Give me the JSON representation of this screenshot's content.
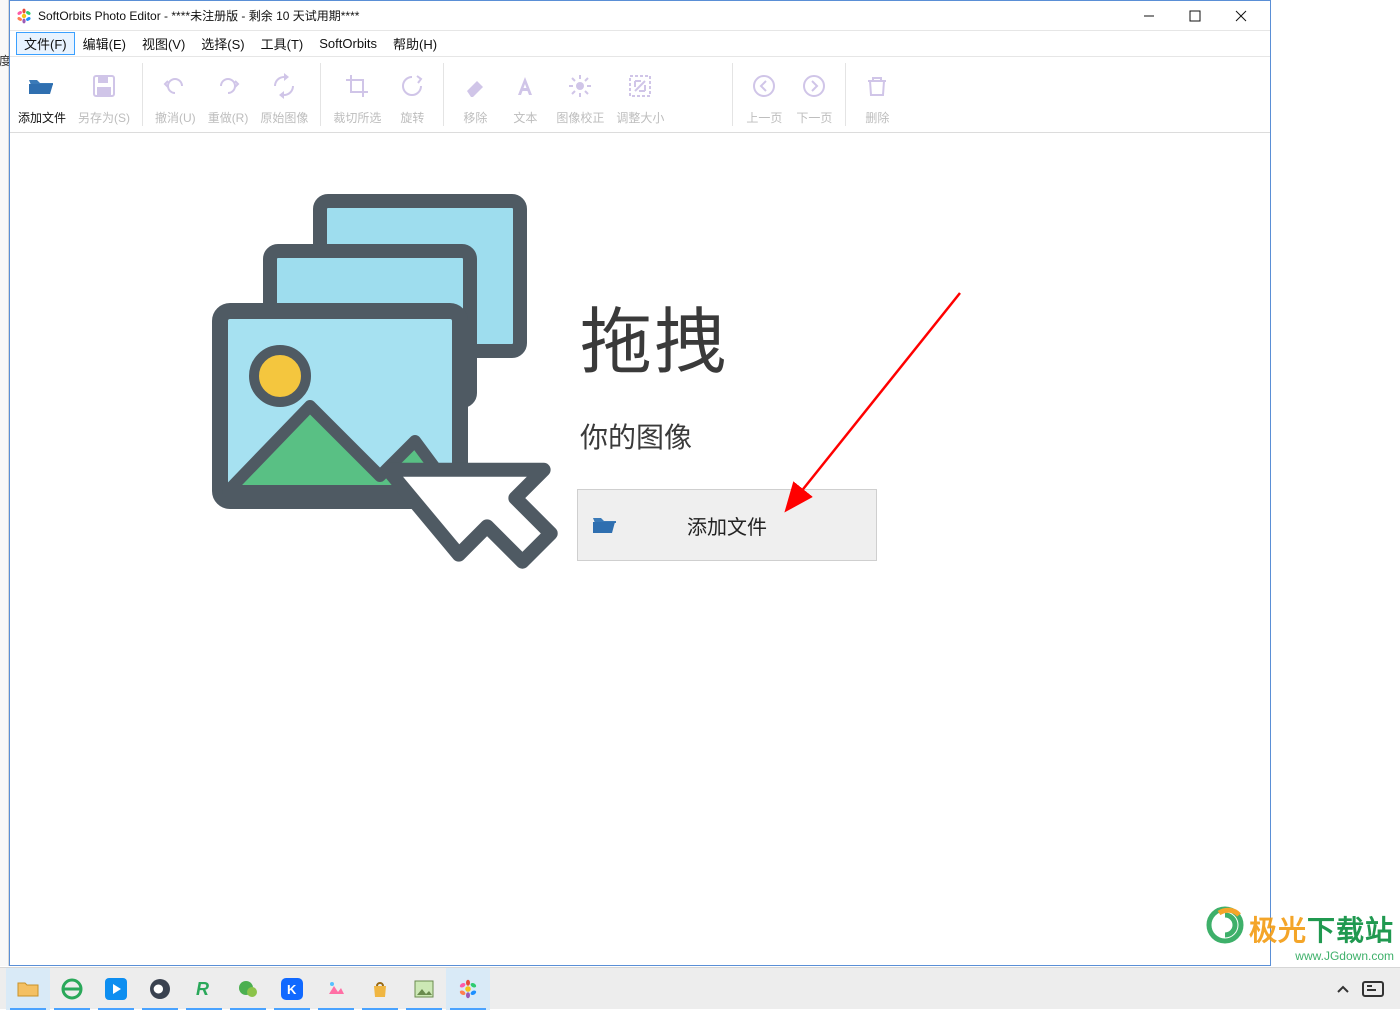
{
  "window": {
    "title": "SoftOrbits Photo Editor - ****未注册版 - 剩余 10 天试用期****"
  },
  "menu": {
    "items": [
      {
        "name": "file",
        "label": "文件(F)",
        "selected": true
      },
      {
        "name": "edit",
        "label": "编辑(E)"
      },
      {
        "name": "view",
        "label": "视图(V)"
      },
      {
        "name": "select",
        "label": "选择(S)"
      },
      {
        "name": "tools",
        "label": "工具(T)"
      },
      {
        "name": "softorbits",
        "label": "SoftOrbits"
      },
      {
        "name": "help",
        "label": "帮助(H)"
      }
    ]
  },
  "toolbar": {
    "add_file": "添加文件",
    "save_as": "另存为(S)",
    "undo": "撤消(U)",
    "redo": "重做(R)",
    "original": "原始图像",
    "crop": "裁切所选",
    "rotate": "旋转",
    "remove": "移除",
    "text": "文本",
    "correction": "图像校正",
    "resize": "调整大小",
    "prev": "上一页",
    "next": "下一页",
    "delete": "删除"
  },
  "canvas": {
    "drag_title": "拖拽",
    "drag_sub": "你的图像",
    "add_button": "添加文件"
  },
  "watermark": {
    "line1_a": "极光",
    "line1_b": "下载站",
    "line2": "www.JGdown.com"
  },
  "annotation": {
    "color": "#ff0000"
  }
}
